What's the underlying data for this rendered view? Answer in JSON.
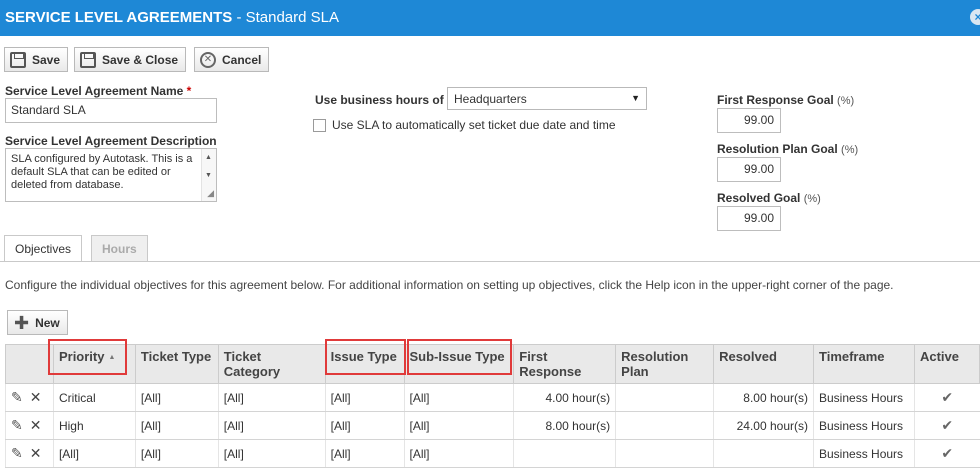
{
  "header": {
    "title": "SERVICE LEVEL AGREEMENTS",
    "subtitle": " - Standard SLA",
    "close_icon": "close-icon"
  },
  "toolbar": {
    "save_label": "Save",
    "save_close_label": "Save & Close",
    "cancel_label": "Cancel"
  },
  "form": {
    "name_label": "Service Level Agreement Name",
    "name_required": "*",
    "name_value": "Standard  SLA",
    "description_label": "Service Level Agreement Description",
    "description_value": "SLA configured by Autotask.  This is a default SLA that can be edited or deleted from database.",
    "business_hours_label": "Use business hours of",
    "business_hours_value": "Headquarters",
    "use_sla_label": "Use SLA to automatically set ticket due date and time",
    "use_sla_checked": false,
    "first_response_label": "First Response Goal",
    "first_response_unit": "(%)",
    "first_response_value": "99.00",
    "resolution_plan_label": "Resolution Plan Goal",
    "resolution_plan_unit": "(%)",
    "resolution_plan_value": "99.00",
    "resolved_label": "Resolved Goal",
    "resolved_unit": "(%)",
    "resolved_value": "99.00"
  },
  "tabs": [
    {
      "label": "Objectives",
      "active": true
    },
    {
      "label": "Hours",
      "active": false
    }
  ],
  "objectives": {
    "info_text": "Configure the individual objectives for this agreement below. For additional information on setting up objectives, click the Help icon in the upper-right corner of the page.",
    "new_label": "New",
    "columns": {
      "priority": "Priority",
      "ticket_type": "Ticket Type",
      "ticket_category": "Ticket Category",
      "issue_type": "Issue Type",
      "sub_issue_type": "Sub-Issue Type",
      "first_response": "First Response",
      "resolution_plan": "Resolution Plan",
      "resolved": "Resolved",
      "timeframe": "Timeframe",
      "active": "Active"
    },
    "rows": [
      {
        "priority": "Critical",
        "ticket_type": "[All]",
        "ticket_category": "[All]",
        "issue_type": "[All]",
        "sub_issue_type": "[All]",
        "first_response": "4.00 hour(s)",
        "resolution_plan": "",
        "resolved": "8.00 hour(s)",
        "timeframe": "Business Hours",
        "active": true
      },
      {
        "priority": "High",
        "ticket_type": "[All]",
        "ticket_category": "[All]",
        "issue_type": "[All]",
        "sub_issue_type": "[All]",
        "first_response": "8.00 hour(s)",
        "resolution_plan": "",
        "resolved": "24.00 hour(s)",
        "timeframe": "Business Hours",
        "active": true
      },
      {
        "priority": "[All]",
        "ticket_type": "[All]",
        "ticket_category": "[All]",
        "issue_type": "[All]",
        "sub_issue_type": "[All]",
        "first_response": "",
        "resolution_plan": "",
        "resolved": "",
        "timeframe": "Business Hours",
        "active": true
      }
    ]
  },
  "colors": {
    "header_bg": "#1e88d6",
    "highlight": "#e03a3a"
  }
}
